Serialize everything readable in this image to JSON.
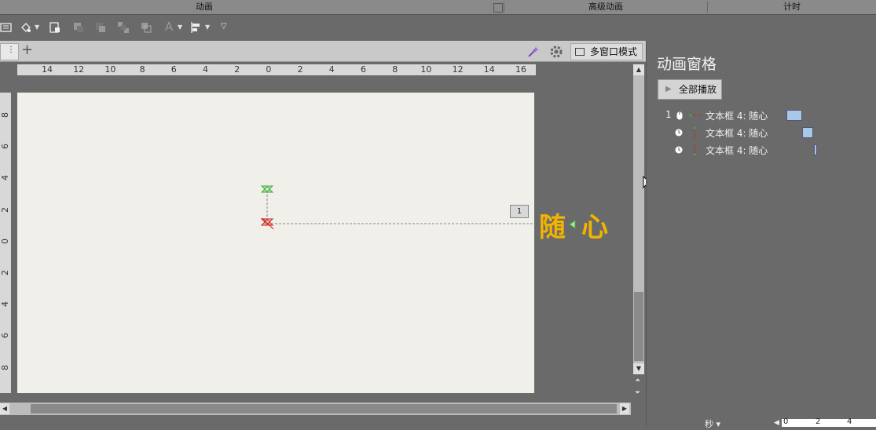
{
  "ribbon_groups": {
    "animation": "动画",
    "advanced": "高级动画",
    "timing": "计时"
  },
  "tabstrip": {
    "plus": "+",
    "multiwindow_label": "多窗口模式"
  },
  "rulers": {
    "horizontal_labels": [
      "14",
      "12",
      "10",
      "8",
      "6",
      "4",
      "2",
      "0",
      "2",
      "4",
      "6",
      "8",
      "10",
      "12",
      "14",
      "16"
    ],
    "vertical_labels": [
      "8",
      "6",
      "4",
      "2",
      "0",
      "2",
      "4",
      "6",
      "8"
    ]
  },
  "slide": {
    "badge": "1",
    "text_char1": "随",
    "text_char2": "心"
  },
  "pane": {
    "title": "动画窗格",
    "play_all": "全部播放",
    "items": [
      {
        "index": "1",
        "trigger": "mouse-icon",
        "label": "文本框 4: 随心"
      },
      {
        "index": "",
        "trigger": "clock-icon",
        "label": "文本框 4: 随心"
      },
      {
        "index": "",
        "trigger": "clock-icon",
        "label": "文本框 4: 随心"
      }
    ],
    "timeline_unit": "秒",
    "timeline_ticks": [
      "0",
      "2",
      "4"
    ]
  },
  "colors": {
    "accent_text": "#f2b400",
    "timing_bar": "#a8c8e8",
    "motion_start": "#44aa44",
    "motion_end": "#cc2222"
  }
}
